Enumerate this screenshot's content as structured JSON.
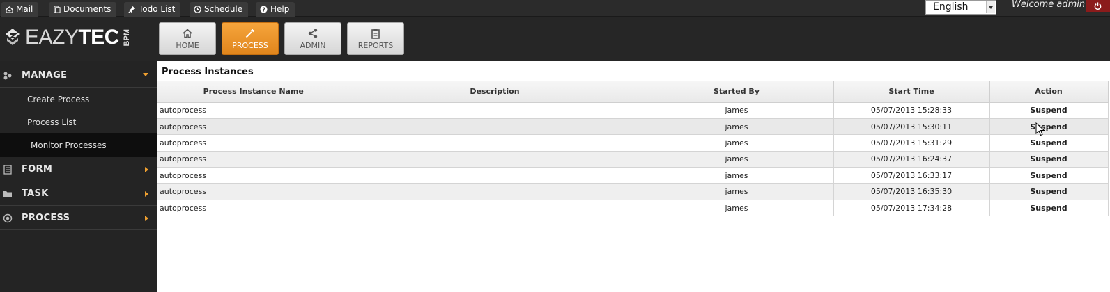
{
  "top_links": [
    {
      "label": "Mail",
      "icon": "mail-icon"
    },
    {
      "label": "Documents",
      "icon": "documents-icon"
    },
    {
      "label": "Todo List",
      "icon": "pin-icon"
    },
    {
      "label": "Schedule",
      "icon": "clock-icon"
    },
    {
      "label": "Help",
      "icon": "help-icon"
    }
  ],
  "language": {
    "selected": "English"
  },
  "welcome_text": "Welcome admin",
  "logo": {
    "part1": "EAZY",
    "part2": "TEC",
    "suffix": "BPM"
  },
  "nav": [
    {
      "label": "HOME",
      "icon": "home-icon",
      "active": false
    },
    {
      "label": "PROCESS",
      "icon": "magic-wand-icon",
      "active": true
    },
    {
      "label": "ADMIN",
      "icon": "share-icon",
      "active": false
    },
    {
      "label": "REPORTS",
      "icon": "clipboard-icon",
      "active": false
    }
  ],
  "sidebar": {
    "manage": {
      "label": "MANAGE",
      "icon": "manage-icon"
    },
    "manage_items": [
      {
        "label": "Create Process"
      },
      {
        "label": "Process List"
      },
      {
        "label": "Monitor Processes",
        "active": true
      }
    ],
    "form": {
      "label": "FORM",
      "icon": "form-icon"
    },
    "task": {
      "label": "TASK",
      "icon": "folder-icon"
    },
    "process": {
      "label": "PROCESS",
      "icon": "process-icon"
    }
  },
  "panel": {
    "title": "Process Instances",
    "columns": [
      "Process Instance Name",
      "Description",
      "Started By",
      "Start Time",
      "Action"
    ],
    "rows": [
      {
        "name": "autoprocess",
        "description": "",
        "started_by": "james",
        "start_time": "05/07/2013 15:28:33",
        "action": "Suspend"
      },
      {
        "name": "autoprocess",
        "description": "",
        "started_by": "james",
        "start_time": "05/07/2013 15:30:11",
        "action": "Suspend"
      },
      {
        "name": "autoprocess",
        "description": "",
        "started_by": "james",
        "start_time": "05/07/2013 15:31:29",
        "action": "Suspend"
      },
      {
        "name": "autoprocess",
        "description": "",
        "started_by": "james",
        "start_time": "05/07/2013 16:24:37",
        "action": "Suspend"
      },
      {
        "name": "autoprocess",
        "description": "",
        "started_by": "james",
        "start_time": "05/07/2013 16:33:17",
        "action": "Suspend"
      },
      {
        "name": "autoprocess",
        "description": "",
        "started_by": "james",
        "start_time": "05/07/2013 16:35:30",
        "action": "Suspend"
      },
      {
        "name": "autoprocess",
        "description": "",
        "started_by": "james",
        "start_time": "05/07/2013 17:34:28",
        "action": "Suspend"
      }
    ]
  },
  "colors": {
    "accent": "#f0a030",
    "active_nav": "#e98f24",
    "sidebar_bg": "#242424",
    "power_bg": "#8b1b1b"
  }
}
